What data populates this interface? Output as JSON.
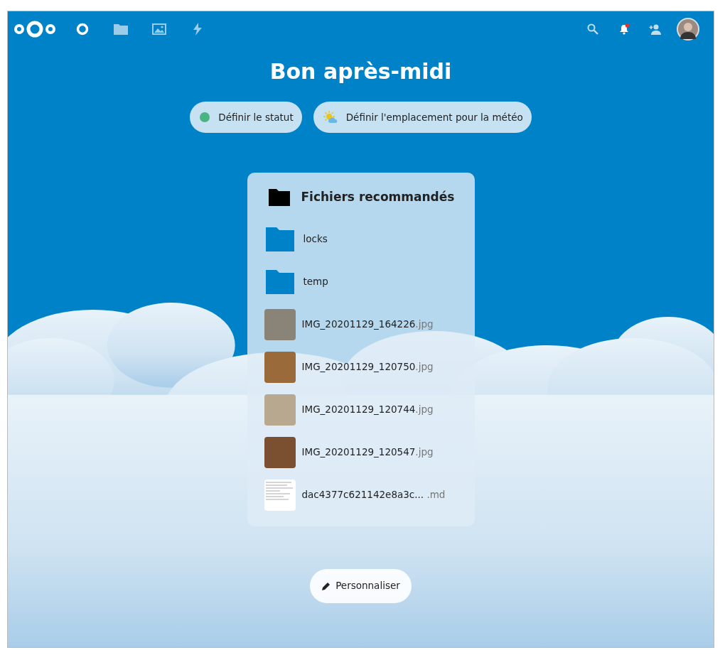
{
  "header": {
    "apps": [
      {
        "kind": "dashboard",
        "selected": true
      },
      {
        "kind": "files",
        "selected": false
      },
      {
        "kind": "photos",
        "selected": false
      },
      {
        "kind": "activity",
        "selected": false
      }
    ],
    "notifications": {
      "unread": true
    }
  },
  "greeting": "Bon après-midi",
  "actions": [
    {
      "kind": "status",
      "label": "Définir le statut",
      "color": "#49b382"
    },
    {
      "kind": "weather",
      "label": "Définir l'emplacement pour la météo"
    }
  ],
  "widget": {
    "title": "Fichiers recommandés",
    "items": [
      {
        "kind": "folder",
        "name": "locks"
      },
      {
        "kind": "folder",
        "name": "temp"
      },
      {
        "kind": "image",
        "name": "IMG_20201129_164226",
        "extension": ".jpg"
      },
      {
        "kind": "image",
        "name": "IMG_20201129_120750",
        "extension": ".jpg"
      },
      {
        "kind": "image",
        "name": "IMG_20201129_120744",
        "extension": ".jpg"
      },
      {
        "kind": "image",
        "name": "IMG_20201129_120547",
        "extension": ".jpg"
      },
      {
        "kind": "document",
        "name": "dac4377c621142e8a3c...",
        "extension": ".md"
      }
    ]
  },
  "customize_button": "Personnaliser"
}
